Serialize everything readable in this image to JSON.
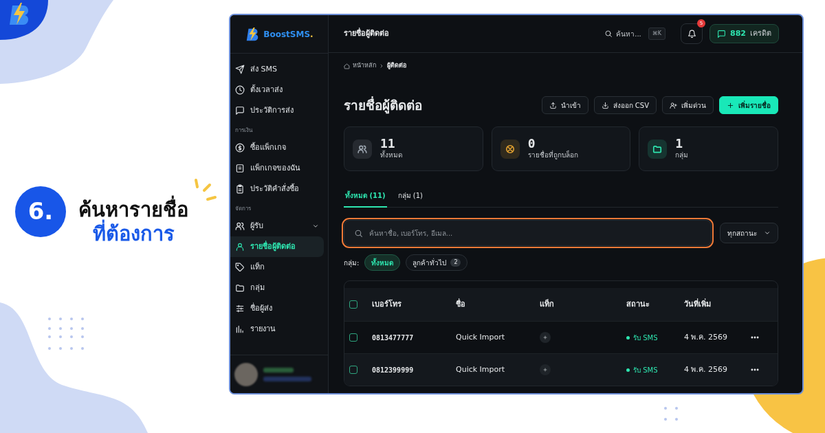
{
  "promo": {
    "step_number": "6.",
    "headline": "ค้นหารายชื่อ",
    "headline_highlight": "ที่ต้องการ"
  },
  "app": {
    "brand": {
      "name": "BoostSMS",
      "dot": "."
    },
    "sidebar": {
      "sections": [
        {
          "items": [
            {
              "label": "ส่ง SMS",
              "selected": false
            },
            {
              "label": "ตั้งเวลาส่ง",
              "selected": false
            },
            {
              "label": "ประวัติการส่ง",
              "selected": false
            }
          ]
        },
        {
          "heading": "การเงิน",
          "items": [
            {
              "label": "ซื้อแพ็กเกจ",
              "selected": false
            },
            {
              "label": "แพ็กเกจของฉัน",
              "selected": false
            },
            {
              "label": "ประวัติคำสั่งซื้อ",
              "selected": false
            }
          ]
        },
        {
          "heading": "จัดการ",
          "items": [
            {
              "label": "ผู้รับ",
              "selected": false,
              "expanded": true
            },
            {
              "label": "รายชื่อผู้ติดต่อ",
              "selected": true
            },
            {
              "label": "แท็ก",
              "selected": false
            },
            {
              "label": "กลุ่ม",
              "selected": false
            },
            {
              "label": "ชื่อผู้ส่ง",
              "selected": false
            },
            {
              "label": "รายงาน",
              "selected": false
            }
          ]
        }
      ]
    },
    "topbar": {
      "title": "รายชื่อผู้ติดต่อ",
      "search": "ค้นหา...",
      "shortcut": "⌘K",
      "notifications": "5",
      "credits": "882",
      "credits_label": "เครดิต"
    },
    "breadcrumb": [
      "หน้าหลัก",
      "ผู้ติดต่อ"
    ],
    "page_title": "รายชื่อผู้ติดต่อ",
    "actions": [
      {
        "label": "นำเข้า",
        "kind": "outline"
      },
      {
        "label": "ส่งออก CSV",
        "kind": "outline"
      },
      {
        "label": "เพิ่มด่วน",
        "kind": "outline"
      },
      {
        "label": "เพิ่มรายชื่อ",
        "kind": "primary"
      }
    ],
    "stats": [
      {
        "value": "11",
        "label": "ทั้งหมด",
        "color": "#9aa3ad"
      },
      {
        "value": "0",
        "label": "รายชื่อที่ถูกบล็อก",
        "color": "#e0a030"
      },
      {
        "value": "1",
        "label": "กลุ่ม",
        "color": "#2ee6b0"
      }
    ],
    "tabs": [
      {
        "label": "ทั้งหมด (11)",
        "selected": true
      },
      {
        "label": "กลุ่ม (1)",
        "selected": false
      }
    ],
    "search": {
      "placeholder": "ค้นหาชื่อ, เบอร์โทร, อีเมล...",
      "highlighted": true
    },
    "status_filter": "ทุกสถานะ",
    "group_filter": {
      "label": "กลุ่ม:",
      "chips": [
        {
          "label": "ทั้งหมด",
          "selected": true
        },
        {
          "label": "ลูกค้าทั่วไป",
          "count": "2",
          "selected": false
        }
      ]
    },
    "table": {
      "select_all_checked": false,
      "columns": [
        "เบอร์โทร",
        "ชื่อ",
        "แท็ก",
        "สถานะ",
        "วันที่เพิ่ม"
      ],
      "rows": [
        {
          "checked": false,
          "phone": "0813477777",
          "name": "Quick Import",
          "status": "รับ SMS",
          "color": "#2ee6b0",
          "date": "4 พ.ค. 2569"
        },
        {
          "checked": false,
          "phone": "0812399999",
          "name": "Quick Import",
          "status": "รับ SMS",
          "color": "#2ee6b0",
          "date": "4 พ.ค. 2569"
        }
      ]
    }
  }
}
